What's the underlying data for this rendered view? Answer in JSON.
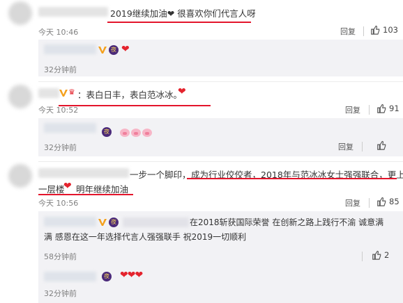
{
  "comments": [
    {
      "text": "2019继续加油❤ 很喜欢你们代言人呀",
      "time": "今天 10:46",
      "reply_label": "回复",
      "likes": "103",
      "sub_reply": {
        "time": "32分钟前",
        "emoji": "❤"
      }
    },
    {
      "text": "：表白日丰，表白范冰冰。",
      "time": "今天 10:52",
      "reply_label": "回复",
      "likes": "91",
      "sub_reply": {
        "time": "32分钟前",
        "reply_label": "回复",
        "emoji": "pig-faces"
      }
    },
    {
      "text_line1_a": "一步一个脚印，",
      "text_line1_b": "成为行业佼佼者，2018年与范冰冰女士强强联合，更上",
      "text_line2_a": "一层楼",
      "text_line2_b": "明年继续加油",
      "time": "今天 10:56",
      "reply_label": "回复",
      "likes": "85",
      "sub_reply": {
        "line1": "在2018斩获国际荣誉 在创新之路上践行不渝 诚意满",
        "line2": "满 感恩在这一年选择代言人强强联手 祝2019一切顺利",
        "time": "58分钟前",
        "likes": "2"
      },
      "sub_reply2": {
        "time": "32分钟前"
      }
    }
  ],
  "colors": {
    "underline": "#e3142b",
    "heart": "#e4232d"
  }
}
